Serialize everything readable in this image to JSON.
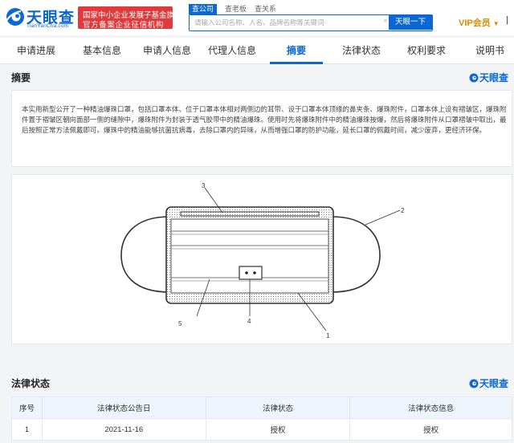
{
  "header": {
    "logo_text": "天眼查",
    "logo_sub": "TianYanCha.com",
    "badge_line1": "国家中小企业发展子基金旗下",
    "badge_line2": "官方备案企业征信机构",
    "search_tabs": [
      "查公司",
      "查老板",
      "查关系"
    ],
    "search_placeholder": "请输入公司名称、人名、品牌名称等关键词",
    "clear_symbol": "×",
    "search_button": "天眼一下",
    "vip_label": "VIP会员",
    "vip_caret": "▼",
    "more_text": "|"
  },
  "tabs": [
    {
      "label": "申请进展"
    },
    {
      "label": "基本信息"
    },
    {
      "label": "申请人信息"
    },
    {
      "label": "代理人信息"
    },
    {
      "label": "摘要"
    },
    {
      "label": "法律状态"
    },
    {
      "label": "权利要求"
    },
    {
      "label": "说明书"
    }
  ],
  "active_tab": "摘要",
  "abstract": {
    "title": "摘要",
    "watermark": "天眼查",
    "text": "本实用新型公开了一种精油爆珠口罩，包括口罩本体、位于口罩本体相对两侧边的耳带、设于口罩本体顶缘的鼻夹条、爆珠附件，口罩本体上设有褶皱区，爆珠附件置于褶皱区朝向面部一侧的缝隙中，爆珠附件为封装于透气胶带中的精油爆珠。使用时先将爆珠附件中的精油爆珠按爆，然后将爆珠附件从口罩褶皱中取出，最后按照正常方法佩戴即可。爆珠中的精油能够抗菌抗病毒，去除口罩内的异味，从而增强口罩的防护功能，延长口罩的佩戴时间，减少废弃，更经济环保。"
  },
  "figure": {
    "labels": [
      "1",
      "2",
      "3",
      "4",
      "5"
    ]
  },
  "legal": {
    "title": "法律状态",
    "watermark": "天眼查",
    "columns": [
      "序号",
      "法律状态公告日",
      "法律状态",
      "法律状态信息"
    ],
    "rows": [
      {
        "index": "1",
        "date": "2021-11-16",
        "status": "授权",
        "info": "授权"
      }
    ]
  },
  "colors": {
    "brand": "#0a67d3",
    "badge": "#e2393a",
    "vip": "#d98b00"
  }
}
